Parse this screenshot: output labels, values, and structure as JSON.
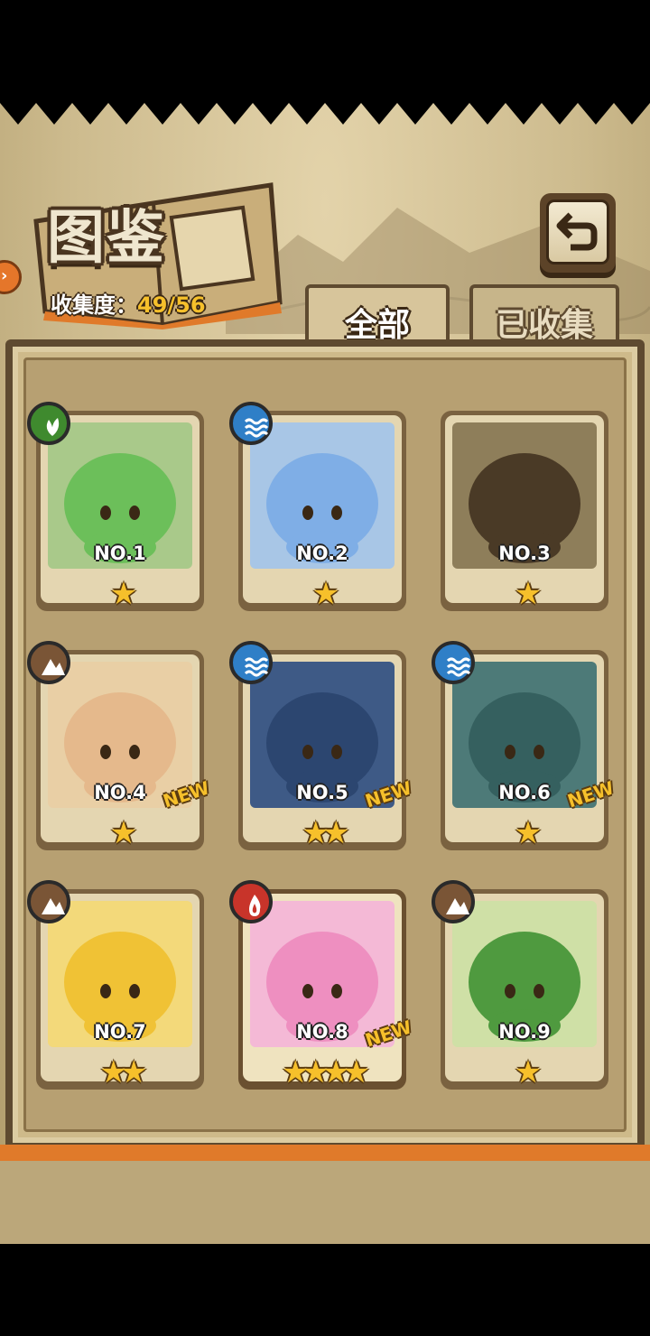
{
  "header": {
    "title": "图鉴",
    "collection_label": "收集度：",
    "collection_value": "49/56"
  },
  "tabs": [
    {
      "label": "全部",
      "active": true
    },
    {
      "label": "已收集",
      "active": false
    }
  ],
  "colors": {
    "grass": "#3f8a2e",
    "water": "#2f7fc7",
    "earth": "#7a5536",
    "fire": "#c8342a",
    "star": "#f6c02b",
    "frame": "#5e4a30"
  },
  "cards": [
    {
      "no": "NO.1",
      "element": "grass-icon",
      "stars": "★",
      "star_count": 1,
      "new": "",
      "art": "green"
    },
    {
      "no": "NO.2",
      "element": "water-icon",
      "stars": "★",
      "star_count": 1,
      "new": "",
      "art": "blue"
    },
    {
      "no": "NO.3",
      "element": "",
      "stars": "★",
      "star_count": 1,
      "new": "",
      "art": "silhouette"
    },
    {
      "no": "NO.4",
      "element": "earth-icon",
      "stars": "★",
      "star_count": 1,
      "new": "NEW",
      "art": "tan"
    },
    {
      "no": "NO.5",
      "element": "water-icon",
      "stars": "★★",
      "star_count": 2,
      "new": "NEW",
      "art": "navy"
    },
    {
      "no": "NO.6",
      "element": "water-icon",
      "stars": "★",
      "star_count": 1,
      "new": "NEW",
      "art": "teal"
    },
    {
      "no": "NO.7",
      "element": "earth-icon",
      "stars": "★★",
      "star_count": 2,
      "new": "",
      "art": "gold"
    },
    {
      "no": "NO.8",
      "element": "fire-icon",
      "stars": "★★★★",
      "star_count": 4,
      "new": "NEW",
      "art": "pink"
    },
    {
      "no": "NO.9",
      "element": "earth-icon",
      "stars": "★",
      "star_count": 1,
      "new": "",
      "art": "leafgirl"
    }
  ]
}
